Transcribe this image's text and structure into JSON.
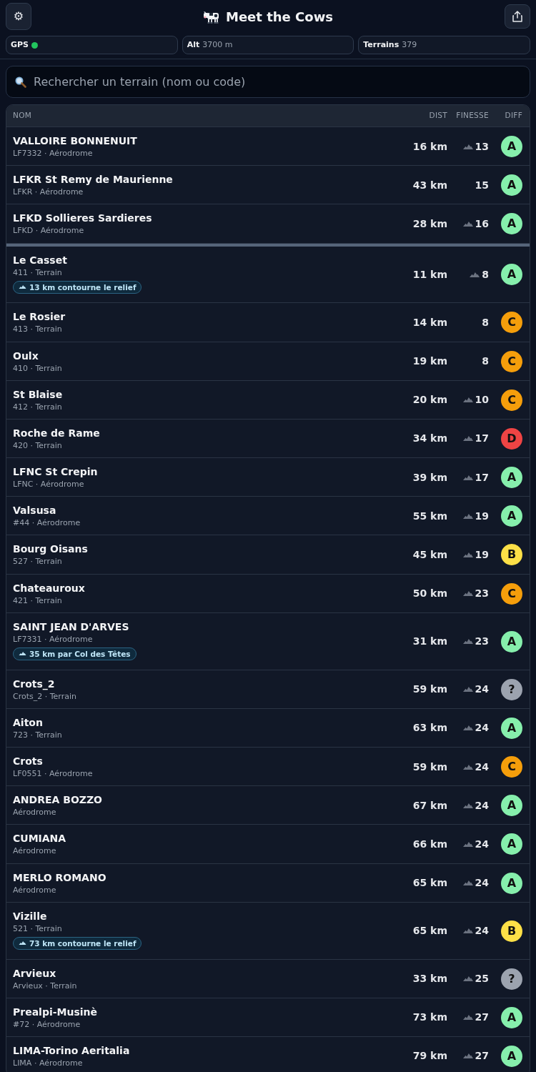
{
  "header": {
    "settings_button": "⚙",
    "title": "Meet the Cows"
  },
  "stats": [
    {
      "kind": "status",
      "label": "GPS",
      "active": true
    },
    {
      "kind": "value",
      "label": "Alt",
      "value": "3700 m"
    },
    {
      "kind": "value",
      "label": "Terrains",
      "value": "379"
    }
  ],
  "search": {
    "placeholder": "Rechercher un terrain (nom ou code)"
  },
  "table": {
    "columns": [
      "NOM",
      "DIST",
      "FINESSE",
      "DIFF"
    ],
    "groups": [
      {
        "rows": [
          {
            "name": "VALLOIRE BONNENUIT",
            "meta": "LF7332 · Aérodrome",
            "dist": "16 km",
            "finesse": "13",
            "relief": true,
            "grade": "A",
            "color": "#86efac"
          },
          {
            "name": "LFKR St Remy de Maurienne",
            "meta": "LFKR · Aérodrome",
            "dist": "43 km",
            "finesse": "15",
            "relief": false,
            "grade": "A",
            "color": "#86efac"
          },
          {
            "name": "LFKD Sollieres Sardieres",
            "meta": "LFKD · Aérodrome",
            "dist": "28 km",
            "finesse": "16",
            "relief": true,
            "grade": "A",
            "color": "#86efac"
          }
        ]
      },
      {
        "rows": [
          {
            "name": "Le Casset",
            "meta": "411 · Terrain",
            "route": "13 km contourne le relief",
            "dist": "11 km",
            "finesse": "8",
            "relief": true,
            "grade": "A",
            "color": "#86efac"
          },
          {
            "name": "Le Rosier",
            "meta": "413 · Terrain",
            "dist": "14 km",
            "finesse": "8",
            "relief": false,
            "grade": "C",
            "color": "#f59e0b"
          },
          {
            "name": "Oulx",
            "meta": "410 · Terrain",
            "dist": "19 km",
            "finesse": "8",
            "relief": false,
            "grade": "C",
            "color": "#f59e0b"
          },
          {
            "name": "St Blaise",
            "meta": "412 · Terrain",
            "dist": "20 km",
            "finesse": "10",
            "relief": true,
            "grade": "C",
            "color": "#f59e0b"
          },
          {
            "name": "Roche de Rame",
            "meta": "420 · Terrain",
            "dist": "34 km",
            "finesse": "17",
            "relief": true,
            "grade": "D",
            "color": "#ef4444"
          },
          {
            "name": "LFNC St Crepin",
            "meta": "LFNC · Aérodrome",
            "dist": "39 km",
            "finesse": "17",
            "relief": true,
            "grade": "A",
            "color": "#86efac"
          },
          {
            "name": "Valsusa",
            "meta": "#44 · Aérodrome",
            "dist": "55 km",
            "finesse": "19",
            "relief": true,
            "grade": "A",
            "color": "#86efac"
          },
          {
            "name": "Bourg Oisans",
            "meta": "527 · Terrain",
            "dist": "45 km",
            "finesse": "19",
            "relief": true,
            "grade": "B",
            "color": "#fde047"
          },
          {
            "name": "Chateauroux",
            "meta": "421 · Terrain",
            "dist": "50 km",
            "finesse": "23",
            "relief": true,
            "grade": "C",
            "color": "#f59e0b"
          },
          {
            "name": "SAINT JEAN D'ARVES",
            "meta": "LF7331 · Aérodrome",
            "route": "35 km par Col des Têtes",
            "dist": "31 km",
            "finesse": "23",
            "relief": true,
            "grade": "A",
            "color": "#86efac"
          },
          {
            "name": "Crots_2",
            "meta": "Crots_2 · Terrain",
            "dist": "59 km",
            "finesse": "24",
            "relief": true,
            "grade": "?",
            "color": "#9ca3af"
          },
          {
            "name": "Aiton",
            "meta": "723 · Terrain",
            "dist": "63 km",
            "finesse": "24",
            "relief": true,
            "grade": "A",
            "color": "#86efac"
          },
          {
            "name": "Crots",
            "meta": "LF0551 · Aérodrome",
            "dist": "59 km",
            "finesse": "24",
            "relief": true,
            "grade": "C",
            "color": "#f59e0b"
          },
          {
            "name": "ANDREA BOZZO",
            "meta": "Aérodrome",
            "dist": "67 km",
            "finesse": "24",
            "relief": true,
            "grade": "A",
            "color": "#86efac"
          },
          {
            "name": "CUMIANA",
            "meta": "Aérodrome",
            "dist": "66 km",
            "finesse": "24",
            "relief": true,
            "grade": "A",
            "color": "#86efac"
          },
          {
            "name": "MERLO ROMANO",
            "meta": "Aérodrome",
            "dist": "65 km",
            "finesse": "24",
            "relief": true,
            "grade": "A",
            "color": "#86efac"
          },
          {
            "name": "Vizille",
            "meta": "521 · Terrain",
            "route": "73 km contourne le relief",
            "dist": "65 km",
            "finesse": "24",
            "relief": true,
            "grade": "B",
            "color": "#fde047"
          },
          {
            "name": "Arvieux",
            "meta": "Arvieux · Terrain",
            "dist": "33 km",
            "finesse": "25",
            "relief": true,
            "grade": "?",
            "color": "#9ca3af"
          },
          {
            "name": "Prealpi-Musinè",
            "meta": "#72 · Aérodrome",
            "dist": "73 km",
            "finesse": "27",
            "relief": true,
            "grade": "A",
            "color": "#86efac"
          },
          {
            "name": "LIMA-Torino Aeritalia",
            "meta": "LIMA · Aérodrome",
            "dist": "79 km",
            "finesse": "27",
            "relief": true,
            "grade": "A",
            "color": "#86efac"
          }
        ]
      }
    ]
  }
}
